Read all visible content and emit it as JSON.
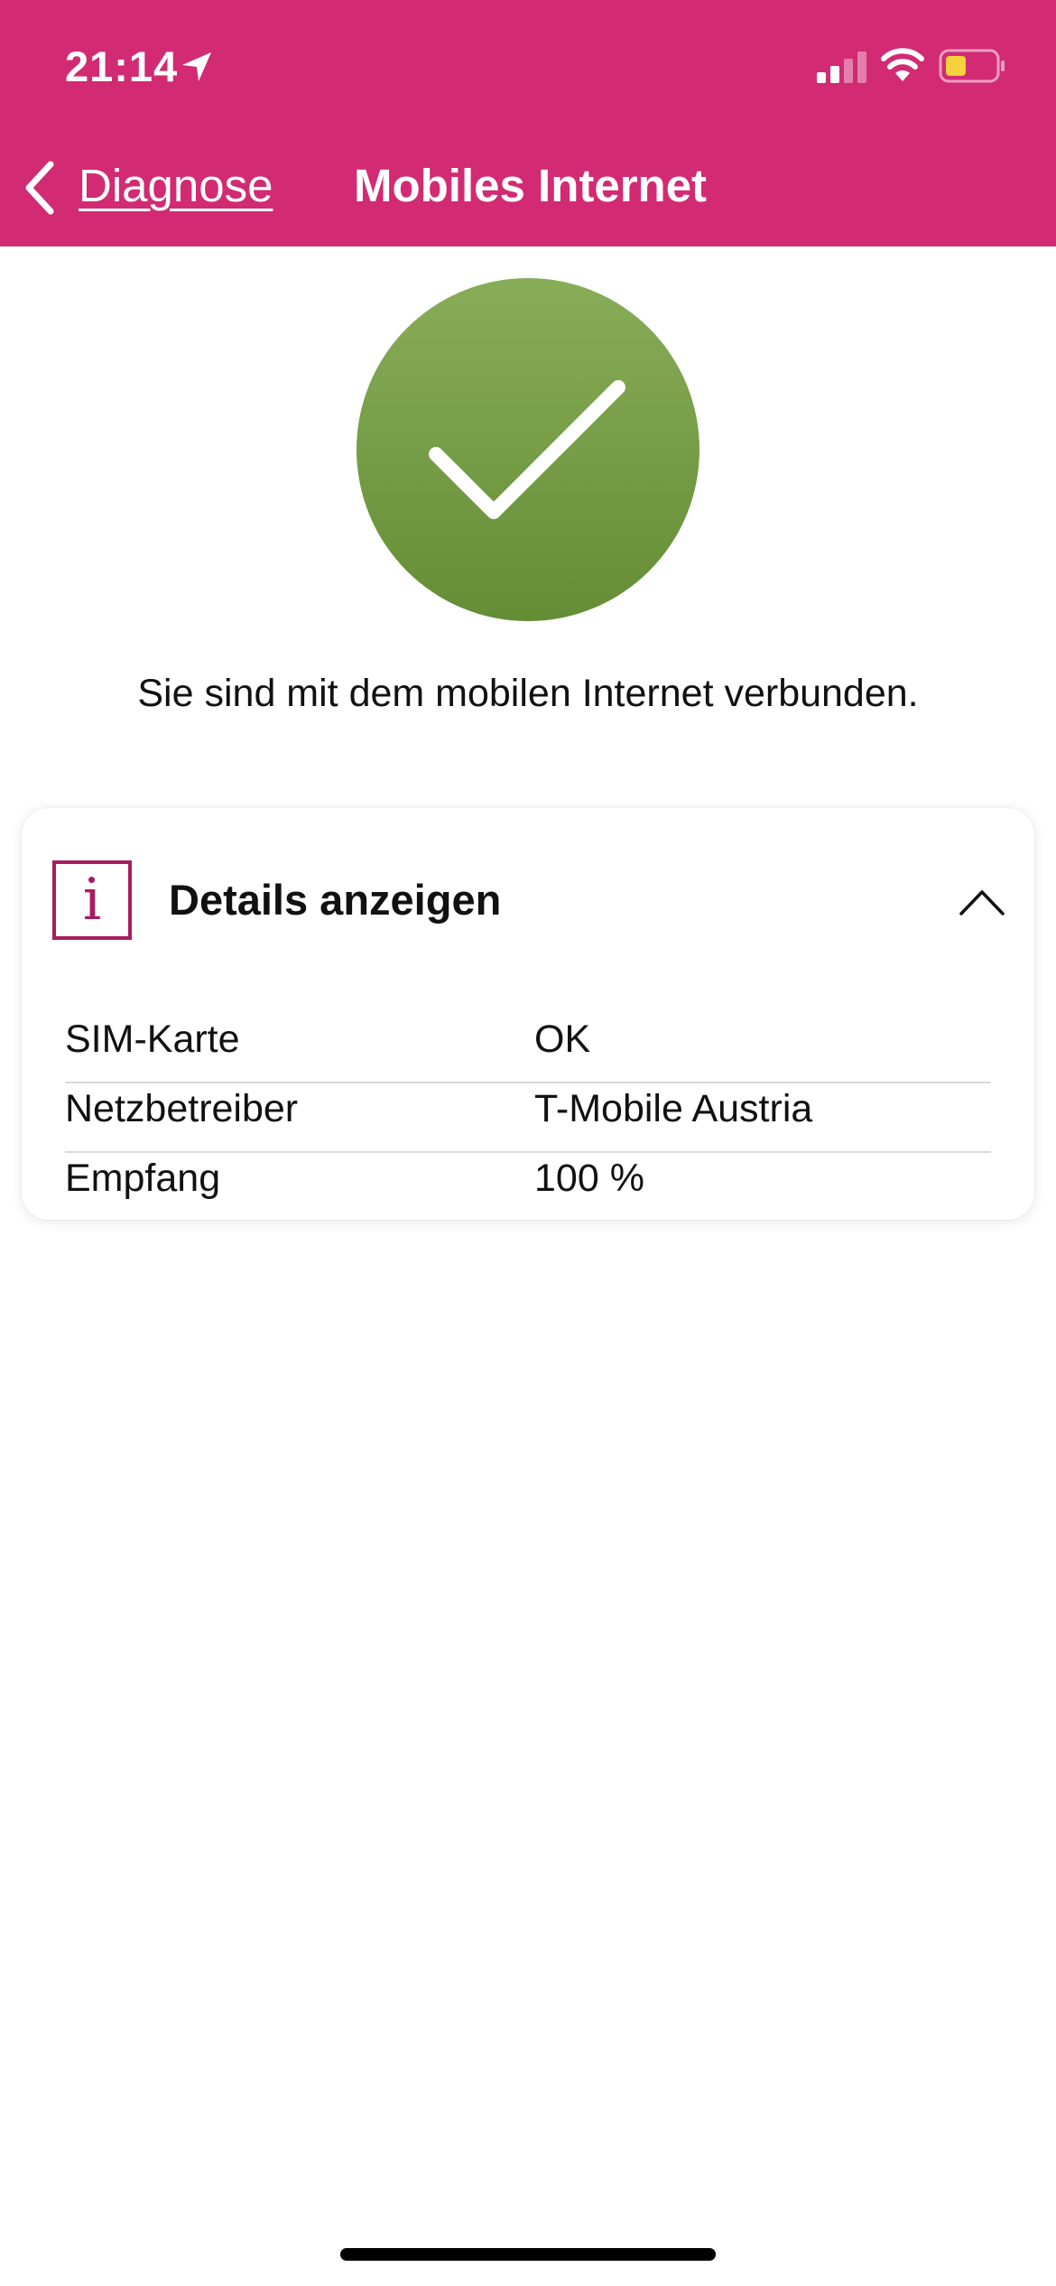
{
  "status_bar": {
    "time": "21:14",
    "icons": [
      "location-arrow-icon",
      "cellular-signal-icon",
      "wifi-icon",
      "battery-low-icon"
    ]
  },
  "nav": {
    "back_label": "Diagnose",
    "title": "Mobiles Internet"
  },
  "status": {
    "icon": "checkmark-circle-icon",
    "message": "Sie sind mit dem mobilen Internet verbunden."
  },
  "details": {
    "title": "Details anzeigen",
    "expanded": true,
    "rows": [
      {
        "label": "SIM-Karte",
        "value": "OK"
      },
      {
        "label": "Netzbetreiber",
        "value": "T-Mobile Austria"
      },
      {
        "label": "Empfang",
        "value": "100 %"
      }
    ]
  },
  "colors": {
    "brand_magenta": "#D22A73",
    "info_icon": "#A61E5F",
    "success_green_top": "#88AD59",
    "success_green_bottom": "#648D35",
    "battery_fill": "#F5D13B"
  }
}
